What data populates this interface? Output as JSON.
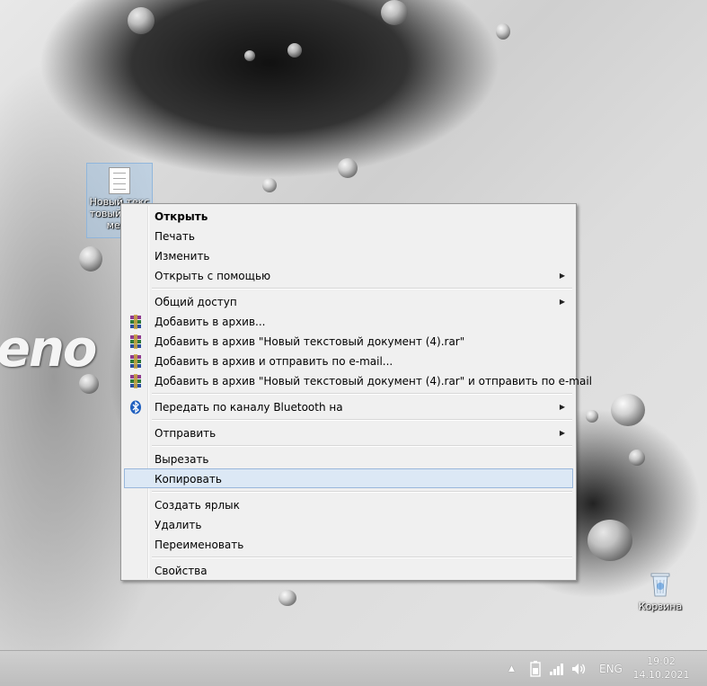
{
  "desktop": {
    "brand_text": "eno",
    "file_icon": {
      "label": "Новый текстовый документ",
      "icon": "text-document-icon"
    },
    "recycle_bin": {
      "label": "Корзина",
      "icon": "recycle-bin-icon"
    }
  },
  "context_menu": {
    "items": [
      {
        "label": "Открыть",
        "bold": true
      },
      {
        "label": "Печать"
      },
      {
        "label": "Изменить"
      },
      {
        "label": "Открыть с помощью",
        "submenu": true
      },
      {
        "label": "Общий доступ",
        "submenu": true
      },
      {
        "label": "Добавить в архив...",
        "icon": "winrar-icon"
      },
      {
        "label": "Добавить в архив \"Новый текстовый документ (4).rar\"",
        "icon": "winrar-icon"
      },
      {
        "label": "Добавить в архив и отправить по e-mail...",
        "icon": "winrar-icon"
      },
      {
        "label": "Добавить в архив \"Новый текстовый документ (4).rar\" и отправить по e-mail",
        "icon": "winrar-icon"
      },
      {
        "label": "Передать по каналу Bluetooth на",
        "submenu": true,
        "icon": "bluetooth-icon"
      },
      {
        "label": "Отправить",
        "submenu": true
      },
      {
        "label": "Вырезать"
      },
      {
        "label": "Копировать",
        "highlighted": true
      },
      {
        "label": "Создать ярлык"
      },
      {
        "label": "Удалить"
      },
      {
        "label": "Переименовать"
      },
      {
        "label": "Свойства"
      }
    ],
    "submenu_arrow": "▶"
  },
  "taskbar": {
    "tray": {
      "show_hidden_icon": "▲",
      "language": "ENG",
      "icons": [
        "chevron-up-icon",
        "battery-icon",
        "network-signal-icon",
        "speaker-icon"
      ]
    },
    "clock": {
      "time": "19:02",
      "date": "14.10.2021"
    }
  },
  "colors": {
    "menu_background": "#f0f0f0",
    "menu_highlight": "#dce8f5",
    "menu_highlight_border": "#99b7db",
    "taskbar": "#c6c6c6"
  }
}
